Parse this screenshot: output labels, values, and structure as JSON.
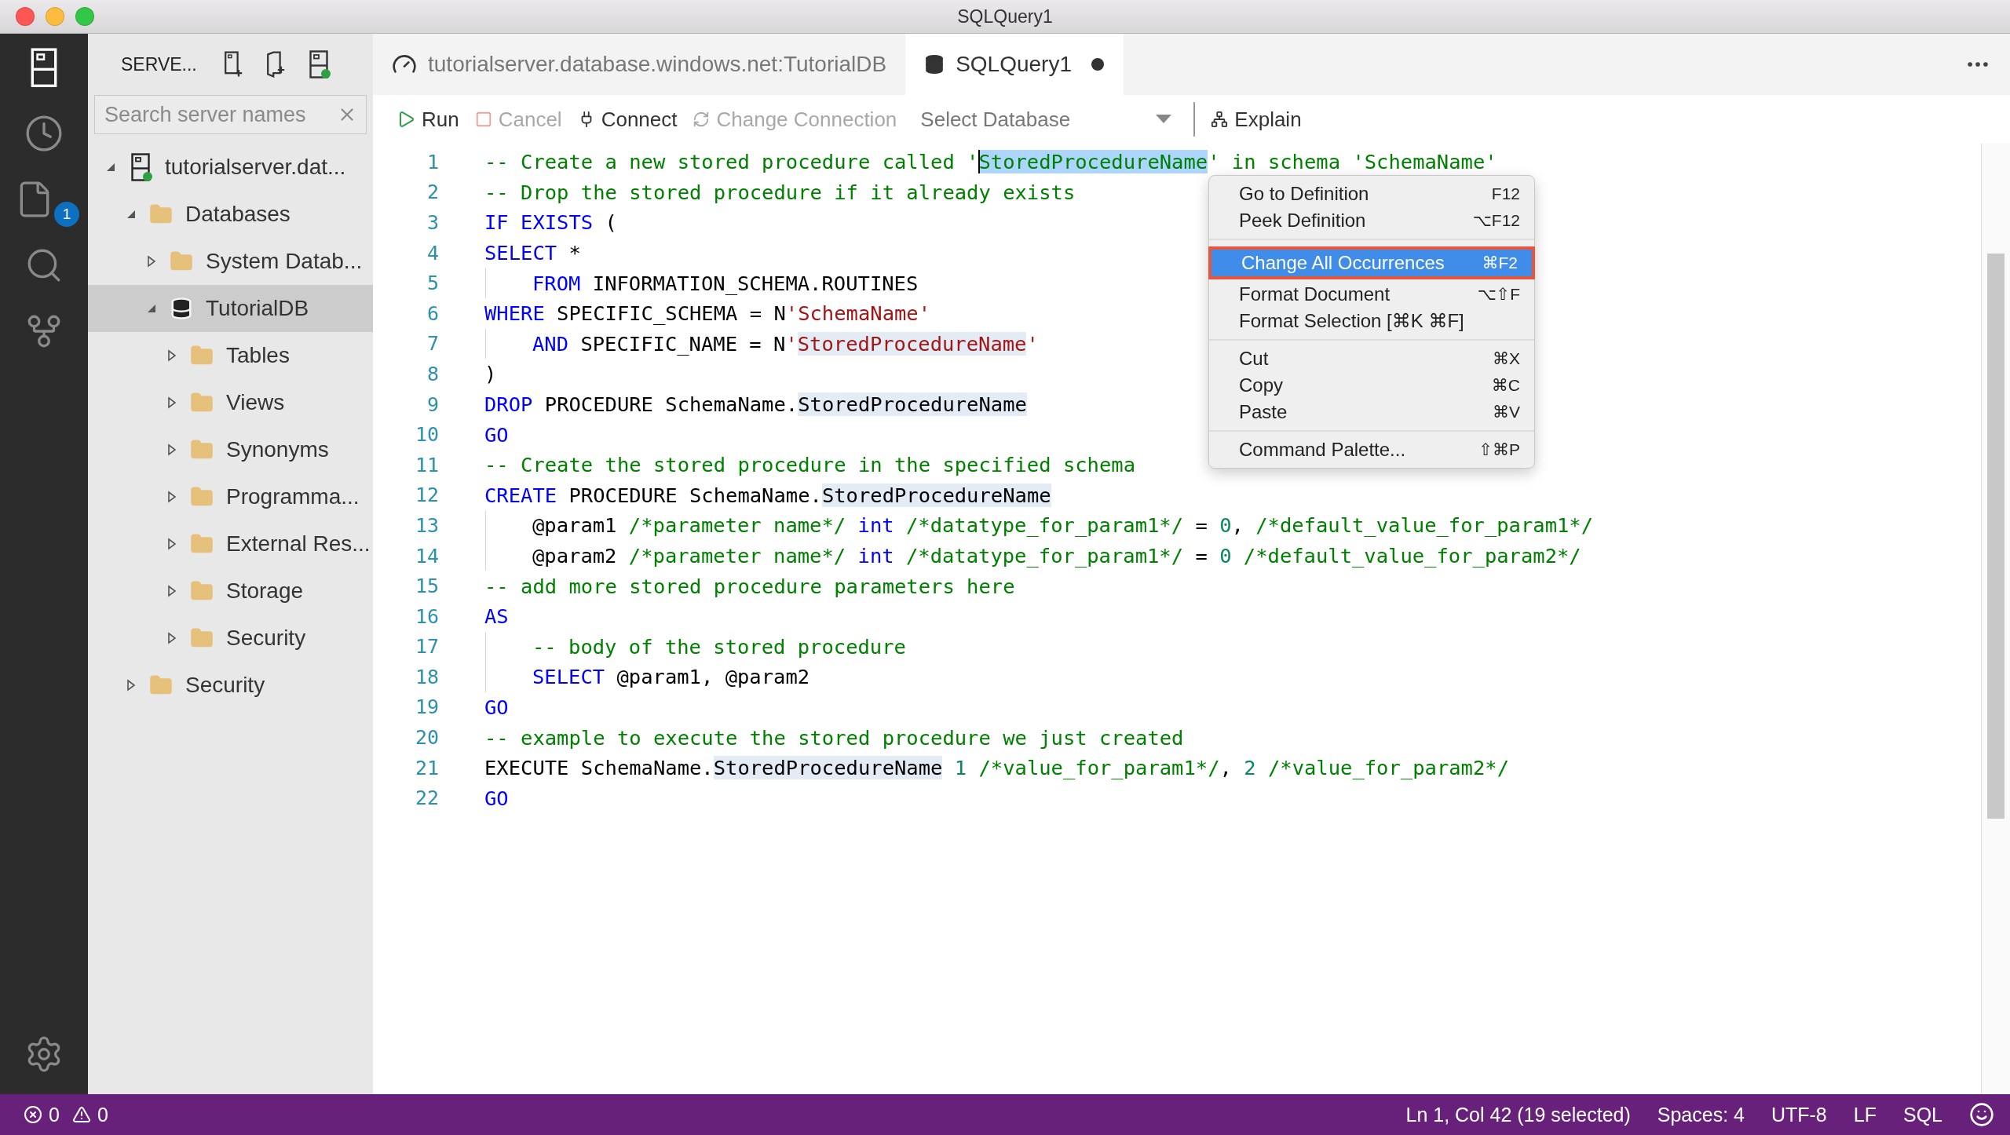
{
  "window": {
    "title": "SQLQuery1"
  },
  "activity_bar": {
    "items": [
      {
        "kind": "servers",
        "selected": true
      },
      {
        "kind": "history",
        "selected": false
      },
      {
        "kind": "explorer",
        "selected": false,
        "badge": "1"
      },
      {
        "kind": "search",
        "selected": false
      },
      {
        "kind": "source-control",
        "selected": false
      }
    ],
    "settings": {
      "kind": "settings"
    }
  },
  "sidebar": {
    "title": "SERVE...",
    "search": {
      "placeholder": "Search server names"
    },
    "tree": [
      {
        "label": "tutorialserver.dat...",
        "kind": "server",
        "expanded": true,
        "selected": false,
        "children": [
          {
            "label": "Databases",
            "kind": "folder",
            "expanded": true,
            "selected": false,
            "children": [
              {
                "label": "System Datab...",
                "kind": "folder",
                "expanded": false,
                "selected": false
              },
              {
                "label": "TutorialDB",
                "kind": "database",
                "expanded": true,
                "selected": true,
                "children": [
                  {
                    "label": "Tables",
                    "kind": "folder",
                    "expanded": false,
                    "selected": false
                  },
                  {
                    "label": "Views",
                    "kind": "folder",
                    "expanded": false,
                    "selected": false
                  },
                  {
                    "label": "Synonyms",
                    "kind": "folder",
                    "expanded": false,
                    "selected": false
                  },
                  {
                    "label": "Programma...",
                    "kind": "folder",
                    "expanded": false,
                    "selected": false
                  },
                  {
                    "label": "External Res...",
                    "kind": "folder",
                    "expanded": false,
                    "selected": false
                  },
                  {
                    "label": "Storage",
                    "kind": "folder",
                    "expanded": false,
                    "selected": false
                  },
                  {
                    "label": "Security",
                    "kind": "folder",
                    "expanded": false,
                    "selected": false
                  }
                ]
              }
            ]
          },
          {
            "label": "Security",
            "kind": "folder",
            "expanded": false,
            "selected": false
          }
        ]
      }
    ]
  },
  "tabs": [
    {
      "label": "tutorialserver.database.windows.net:TutorialDB",
      "kind": "dashboard",
      "selected": false,
      "dirty": false
    },
    {
      "label": "SQLQuery1",
      "kind": "query",
      "selected": true,
      "dirty": true
    }
  ],
  "toolbar": {
    "buttons": [
      {
        "label": "Run",
        "kind": "run",
        "disabled": false
      },
      {
        "label": "Cancel",
        "kind": "cancel",
        "disabled": true
      },
      {
        "label": "Connect",
        "kind": "connect",
        "disabled": false
      },
      {
        "label": "Change Connection",
        "kind": "change",
        "disabled": true
      }
    ],
    "database_select": {
      "placeholder": "Select Database"
    },
    "explain": {
      "label": "Explain"
    }
  },
  "code_lines": [
    {
      "number": "1",
      "indented": false,
      "tokens": [
        {
          "text": "-- Create a new stored procedure called '",
          "kind": "comment",
          "highlighted": false,
          "selected": false
        },
        {
          "text": "StoredProcedureName",
          "kind": "comment",
          "highlighted": true,
          "selected": true
        },
        {
          "text": "' in schema 'SchemaName'",
          "kind": "comment",
          "highlighted": false,
          "selected": false
        }
      ]
    },
    {
      "number": "2",
      "indented": false,
      "tokens": [
        {
          "text": "-- Drop the stored procedure if it already exists",
          "kind": "comment",
          "highlighted": false,
          "selected": false
        }
      ]
    },
    {
      "number": "3",
      "indented": false,
      "tokens": [
        {
          "text": "IF EXISTS",
          "kind": "keyword",
          "highlighted": false,
          "selected": false
        },
        {
          "text": " (",
          "kind": "plain",
          "highlighted": false,
          "selected": false
        }
      ]
    },
    {
      "number": "4",
      "indented": false,
      "tokens": [
        {
          "text": "SELECT",
          "kind": "keyword",
          "highlighted": false,
          "selected": false
        },
        {
          "text": " *",
          "kind": "plain",
          "highlighted": false,
          "selected": false
        }
      ]
    },
    {
      "number": "5",
      "indented": true,
      "tokens": [
        {
          "text": "FROM",
          "kind": "keyword",
          "highlighted": false,
          "selected": false
        },
        {
          "text": " INFORMATION_SCHEMA.ROUTINES",
          "kind": "plain",
          "highlighted": false,
          "selected": false
        }
      ]
    },
    {
      "number": "6",
      "indented": false,
      "tokens": [
        {
          "text": "WHERE",
          "kind": "keyword",
          "highlighted": false,
          "selected": false
        },
        {
          "text": " SPECIFIC_SCHEMA = N",
          "kind": "plain",
          "highlighted": false,
          "selected": false
        },
        {
          "text": "'SchemaName'",
          "kind": "string",
          "highlighted": false,
          "selected": false
        }
      ]
    },
    {
      "number": "7",
      "indented": true,
      "tokens": [
        {
          "text": "AND",
          "kind": "keyword",
          "highlighted": false,
          "selected": false
        },
        {
          "text": " SPECIFIC_NAME = N",
          "kind": "plain",
          "highlighted": false,
          "selected": false
        },
        {
          "text": "'",
          "kind": "string",
          "highlighted": false,
          "selected": false
        },
        {
          "text": "StoredProcedureName",
          "kind": "string",
          "highlighted": true,
          "selected": false
        },
        {
          "text": "'",
          "kind": "string",
          "highlighted": false,
          "selected": false
        }
      ]
    },
    {
      "number": "8",
      "indented": false,
      "tokens": [
        {
          "text": ")",
          "kind": "plain",
          "highlighted": false,
          "selected": false
        }
      ]
    },
    {
      "number": "9",
      "indented": false,
      "tokens": [
        {
          "text": "DROP",
          "kind": "keyword",
          "highlighted": false,
          "selected": false
        },
        {
          "text": " PROCEDURE SchemaName.",
          "kind": "plain",
          "highlighted": false,
          "selected": false
        },
        {
          "text": "StoredProcedureName",
          "kind": "plain",
          "highlighted": true,
          "selected": false
        }
      ]
    },
    {
      "number": "10",
      "indented": false,
      "tokens": [
        {
          "text": "GO",
          "kind": "keyword",
          "highlighted": false,
          "selected": false
        }
      ]
    },
    {
      "number": "11",
      "indented": false,
      "tokens": [
        {
          "text": "-- Create the stored procedure in the specified schema",
          "kind": "comment",
          "highlighted": false,
          "selected": false
        }
      ]
    },
    {
      "number": "12",
      "indented": false,
      "tokens": [
        {
          "text": "CREATE",
          "kind": "keyword",
          "highlighted": false,
          "selected": false
        },
        {
          "text": " PROCEDURE SchemaName.",
          "kind": "plain",
          "highlighted": false,
          "selected": false
        },
        {
          "text": "StoredProcedureName",
          "kind": "plain",
          "highlighted": true,
          "selected": false
        }
      ]
    },
    {
      "number": "13",
      "indented": true,
      "tokens": [
        {
          "text": "@param1 ",
          "kind": "plain",
          "highlighted": false,
          "selected": false
        },
        {
          "text": "/*parameter name*/ ",
          "kind": "comment",
          "highlighted": false,
          "selected": false
        },
        {
          "text": "int",
          "kind": "keyword",
          "highlighted": false,
          "selected": false
        },
        {
          "text": " /*datatype_for_param1*/",
          "kind": "comment",
          "highlighted": false,
          "selected": false
        },
        {
          "text": " = ",
          "kind": "plain",
          "highlighted": false,
          "selected": false
        },
        {
          "text": "0",
          "kind": "number",
          "highlighted": false,
          "selected": false
        },
        {
          "text": ", ",
          "kind": "plain",
          "highlighted": false,
          "selected": false
        },
        {
          "text": "/*default_value_for_param1*/",
          "kind": "comment",
          "highlighted": false,
          "selected": false
        }
      ]
    },
    {
      "number": "14",
      "indented": true,
      "tokens": [
        {
          "text": "@param2 ",
          "kind": "plain",
          "highlighted": false,
          "selected": false
        },
        {
          "text": "/*parameter name*/ ",
          "kind": "comment",
          "highlighted": false,
          "selected": false
        },
        {
          "text": "int",
          "kind": "keyword",
          "highlighted": false,
          "selected": false
        },
        {
          "text": " /*datatype_for_param1*/",
          "kind": "comment",
          "highlighted": false,
          "selected": false
        },
        {
          "text": " = ",
          "kind": "plain",
          "highlighted": false,
          "selected": false
        },
        {
          "text": "0",
          "kind": "number",
          "highlighted": false,
          "selected": false
        },
        {
          "text": " /*default_value_for_param2*/",
          "kind": "comment",
          "highlighted": false,
          "selected": false
        }
      ]
    },
    {
      "number": "15",
      "indented": false,
      "tokens": [
        {
          "text": "-- add more stored procedure parameters here",
          "kind": "comment",
          "highlighted": false,
          "selected": false
        }
      ]
    },
    {
      "number": "16",
      "indented": false,
      "tokens": [
        {
          "text": "AS",
          "kind": "keyword",
          "highlighted": false,
          "selected": false
        }
      ]
    },
    {
      "number": "17",
      "indented": true,
      "tokens": [
        {
          "text": "-- body of the stored procedure",
          "kind": "comment",
          "highlighted": false,
          "selected": false
        }
      ]
    },
    {
      "number": "18",
      "indented": true,
      "tokens": [
        {
          "text": "SELECT",
          "kind": "keyword",
          "highlighted": false,
          "selected": false
        },
        {
          "text": " @param1, @param2",
          "kind": "plain",
          "highlighted": false,
          "selected": false
        }
      ]
    },
    {
      "number": "19",
      "indented": false,
      "tokens": [
        {
          "text": "GO",
          "kind": "keyword",
          "highlighted": false,
          "selected": false
        }
      ]
    },
    {
      "number": "20",
      "indented": false,
      "tokens": [
        {
          "text": "-- example to execute the stored procedure we just created",
          "kind": "comment",
          "highlighted": false,
          "selected": false
        }
      ]
    },
    {
      "number": "21",
      "indented": false,
      "tokens": [
        {
          "text": "EXECUTE SchemaName.",
          "kind": "plain",
          "highlighted": false,
          "selected": false
        },
        {
          "text": "StoredProcedureName",
          "kind": "plain",
          "highlighted": true,
          "selected": false
        },
        {
          "text": " 1 ",
          "kind": "number",
          "highlighted": false,
          "selected": false
        },
        {
          "text": "/*value_for_param1*/",
          "kind": "comment",
          "highlighted": false,
          "selected": false
        },
        {
          "text": ", ",
          "kind": "plain",
          "highlighted": false,
          "selected": false
        },
        {
          "text": "2 ",
          "kind": "number",
          "highlighted": false,
          "selected": false
        },
        {
          "text": "/*value_for_param2*/",
          "kind": "comment",
          "highlighted": false,
          "selected": false
        }
      ]
    },
    {
      "number": "22",
      "indented": false,
      "tokens": [
        {
          "text": "GO",
          "kind": "keyword",
          "highlighted": false,
          "selected": false
        }
      ]
    }
  ],
  "context_menu": {
    "groups": [
      [
        {
          "label": "Go to Definition",
          "shortcut": "F12",
          "selected": false
        },
        {
          "label": "Peek Definition",
          "shortcut": "⌥F12",
          "selected": false
        }
      ],
      [
        {
          "label": "Change All Occurrences",
          "shortcut": "⌘F2",
          "selected": true
        },
        {
          "label": "Format Document",
          "shortcut": "⌥⇧F",
          "selected": false
        },
        {
          "label": "Format Selection [⌘K ⌘F]",
          "selected": false
        }
      ],
      [
        {
          "label": "Cut",
          "shortcut": "⌘X",
          "selected": false
        },
        {
          "label": "Copy",
          "shortcut": "⌘C",
          "selected": false
        },
        {
          "label": "Paste",
          "shortcut": "⌘V",
          "selected": false
        }
      ],
      [
        {
          "label": "Command Palette...",
          "shortcut": "⇧⌘P",
          "selected": false
        }
      ]
    ]
  },
  "status_bar": {
    "errors": "0",
    "warnings": "0",
    "items": [
      "Ln 1, Col 42 (19 selected)",
      "Spaces: 4",
      "UTF-8",
      "LF",
      "SQL"
    ]
  }
}
